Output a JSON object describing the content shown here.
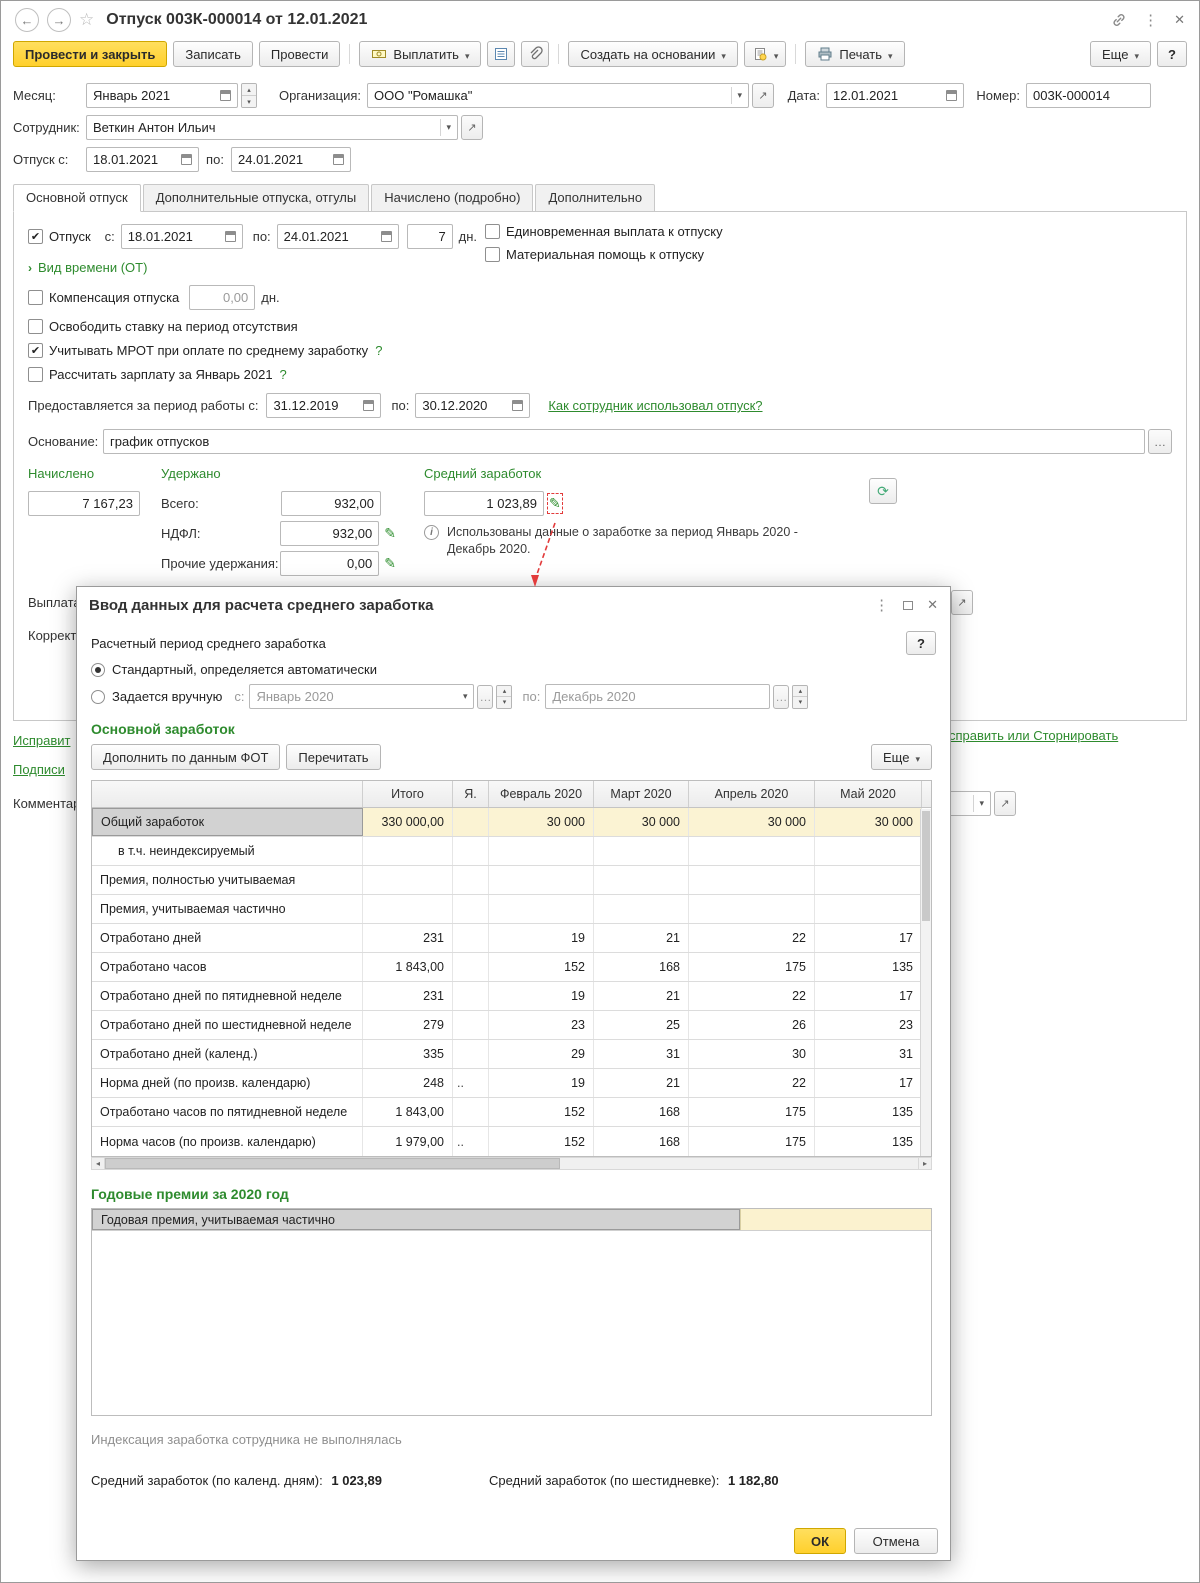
{
  "colors": {
    "primary_button": "#FFD64F",
    "green_accent": "#2E8B2E",
    "highlight_row": "#FBF3D3",
    "selected_cell": "#D2D2D2",
    "annotation_red": "#E23B3B"
  },
  "window": {
    "title": "Отпуск 003К-000014 от 12.01.2021",
    "toolbar": {
      "post_and_close": "Провести и закрыть",
      "write": "Записать",
      "post": "Провести",
      "pay": "Выплатить",
      "create_based_on": "Создать на основании",
      "print": "Печать",
      "more": "Еще",
      "help": "?"
    },
    "fields": {
      "month_label": "Месяц:",
      "month_value": "Январь 2021",
      "org_label": "Организация:",
      "org_value": "ООО \"Ромашка\"",
      "date_label": "Дата:",
      "date_value": "12.01.2021",
      "number_label": "Номер:",
      "number_value": "003К-000014",
      "employee_label": "Сотрудник:",
      "employee_value": "Веткин Антон Ильич",
      "vacation_from_label": "Отпуск с:",
      "vacation_from_value": "18.01.2021",
      "to_label": "по:",
      "vacation_to_value": "24.01.2021"
    },
    "tabs": [
      {
        "label": "Основной отпуск",
        "active": true
      },
      {
        "label": "Дополнительные отпуска, отгулы",
        "active": false
      },
      {
        "label": "Начислено (подробно)",
        "active": false
      },
      {
        "label": "Дополнительно",
        "active": false
      }
    ],
    "main_tab": {
      "vacation_label": "Отпуск",
      "from_label": "с:",
      "from_value": "18.01.2021",
      "to_label": "по:",
      "to_value": "24.01.2021",
      "days_value": "7",
      "days_label": "дн.",
      "lump_sum_label": "Единовременная выплата к отпуску",
      "material_aid_label": "Материальная помощь к отпуску",
      "time_kind_label": "Вид времени (ОТ)",
      "compensation_label": "Компенсация отпуска",
      "compensation_value": "0,00",
      "compensation_days_label": "дн.",
      "release_rate_label": "Освободить ставку на период отсутствия",
      "mrot_label": "Учитывать МРОТ при оплате по среднему заработку",
      "question_mark": "?",
      "calc_salary_label": "Рассчитать зарплату за Январь 2021",
      "work_period_label": "Предоставляется за период работы с:",
      "work_period_from": "31.12.2019",
      "work_period_to_label": "по:",
      "work_period_to": "30.12.2020",
      "vacation_usage_link": "Как сотрудник использовал отпуск?",
      "basis_label": "Основание:",
      "basis_value": "график отпусков",
      "accrued_header": "Начислено",
      "accrued_value": "7 167,23",
      "withheld_header": "Удержано",
      "total_label": "Всего:",
      "total_value": "932,00",
      "ndfl_label": "НДФЛ:",
      "ndfl_value": "932,00",
      "other_deductions_label": "Прочие удержания:",
      "other_deductions_value": "0,00",
      "avg_earnings_header": "Средний заработок",
      "avg_earnings_value": "1 023,89",
      "earnings_info": "Использованы данные о заработке за период Январь 2020 - Декабрь 2020."
    },
    "fragments": {
      "payout_label": "Выплата",
      "correction_label": "Коррект",
      "fix_left_link": "Исправит",
      "fix_right_link": "справить или Сторнировать",
      "signatures_link": "Подписи",
      "comment_label": "Комментари"
    }
  },
  "dialog": {
    "title": "Ввод данных для расчета среднего заработка",
    "help": "?",
    "period_section_label": "Расчетный период среднего заработка",
    "radio_standard": "Стандартный, определяется автоматически",
    "radio_manual": "Задается вручную",
    "manual_from_label": "с:",
    "manual_from_value": "Январь 2020",
    "manual_to_label": "по:",
    "manual_to_value": "Декабрь 2020",
    "main_earnings_title": "Основной заработок",
    "btn_fill_fot": "Дополнить по данным ФОТ",
    "btn_reread": "Перечитать",
    "btn_more": "Еще",
    "table": {
      "headers": [
        "",
        "Итого",
        "Я.",
        "Февраль 2020",
        "Март 2020",
        "Апрель 2020",
        "Май 2020"
      ],
      "rows": [
        {
          "label": "Общий заработок",
          "selected": true,
          "highlight": true,
          "cells": [
            "330 000,00",
            "",
            "30 000",
            "30 000",
            "30 000",
            "30 000"
          ]
        },
        {
          "label": "в т.ч. неиндексируемый",
          "indent": true,
          "cells": [
            "",
            "",
            "",
            "",
            "",
            ""
          ]
        },
        {
          "label": "Премия, полностью учитываемая",
          "cells": [
            "",
            "",
            "",
            "",
            "",
            ""
          ]
        },
        {
          "label": "Премия, учитываемая частично",
          "cells": [
            "",
            "",
            "",
            "",
            "",
            ""
          ]
        },
        {
          "label": "Отработано дней",
          "cells": [
            "231",
            "",
            "19",
            "21",
            "22",
            "17"
          ]
        },
        {
          "label": "Отработано часов",
          "cells": [
            "1 843,00",
            "",
            "152",
            "168",
            "175",
            "135"
          ]
        },
        {
          "label": "Отработано дней по пятидневной неделе",
          "cells": [
            "231",
            "",
            "19",
            "21",
            "22",
            "17"
          ]
        },
        {
          "label": "Отработано дней по шестидневной неделе",
          "cells": [
            "279",
            "",
            "23",
            "25",
            "26",
            "23"
          ]
        },
        {
          "label": "Отработано дней (календ.)",
          "cells": [
            "335",
            "",
            "29",
            "31",
            "30",
            "31"
          ]
        },
        {
          "label": "Норма дней (по произв. календарю)",
          "cells": [
            "248",
            "..",
            "19",
            "21",
            "22",
            "17"
          ]
        },
        {
          "label": "Отработано часов по пятидневной неделе",
          "cells": [
            "1 843,00",
            "",
            "152",
            "168",
            "175",
            "135"
          ]
        },
        {
          "label": "Норма часов (по произв. календарю)",
          "cells": [
            "1 979,00",
            "..",
            "152",
            "168",
            "175",
            "135"
          ]
        }
      ]
    },
    "annual_title": "Годовые премии за 2020 год",
    "annual_row_label": "Годовая премия, учитываемая частично",
    "indexation_note": "Индексация заработка сотрудника не выполнялась",
    "avg_calendar_label": "Средний заработок (по календ. дням):",
    "avg_calendar_value": "1 023,89",
    "avg_sixday_label": "Средний заработок (по шестидневке):",
    "avg_sixday_value": "1 182,80",
    "ok": "ОК",
    "cancel": "Отмена"
  }
}
